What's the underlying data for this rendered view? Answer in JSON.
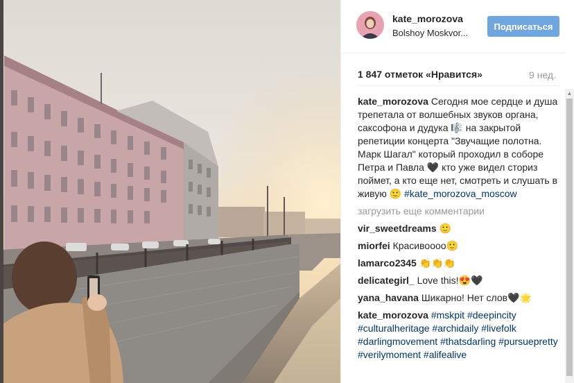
{
  "post": {
    "username": "kate_morozova",
    "location": "Bolshoy Moskvor...",
    "follow_label": "Подписаться",
    "likes": "1 847 отметок «Нравится»",
    "time_ago": "9 нед.",
    "caption": {
      "author": "kate_morozova",
      "text": " Сегодня мое сердце и душа трепетала от волшебных звуков органа, саксофона и дудука 🎼 на закрытой репетиции концерта \"Звучащие полотна. Марк Шагал\" который проходил в соборе Петра и Павла 🖤 кто уже видел сториз поймет, а кто еще нет, смотреть и слушать в живую 🙂 ",
      "hashtag": "#kate_morozova_moscow"
    },
    "load_more": "загрузить еще комментарии",
    "comments": [
      {
        "author": "vir_sweetdreams",
        "text": " 🙂"
      },
      {
        "author": "miorfei",
        "text": " Красивоооо🙂"
      },
      {
        "author": "lamarco2345",
        "text": " 👏👏👏"
      },
      {
        "author": "delicategirl_",
        "text": " Love this!😍🖤"
      },
      {
        "author": "yana_havana",
        "text": " Шикарно! Нет слов🖤🌟"
      }
    ],
    "last_comment": {
      "author": "kate_morozova",
      "tags": [
        "#mskpit",
        "#deepincity",
        "#culturalheritage",
        "#archidaily",
        "#livefolk",
        "#darlingmovement",
        "#thatsdarling",
        "#pursuepretty",
        "#verilymoment",
        "#alifealive"
      ]
    }
  },
  "colors": {
    "follow_button": "#70a6e0",
    "hashtag": "#003569",
    "muted": "#999999"
  },
  "icons": {
    "scroll_up": "triangle-up"
  }
}
